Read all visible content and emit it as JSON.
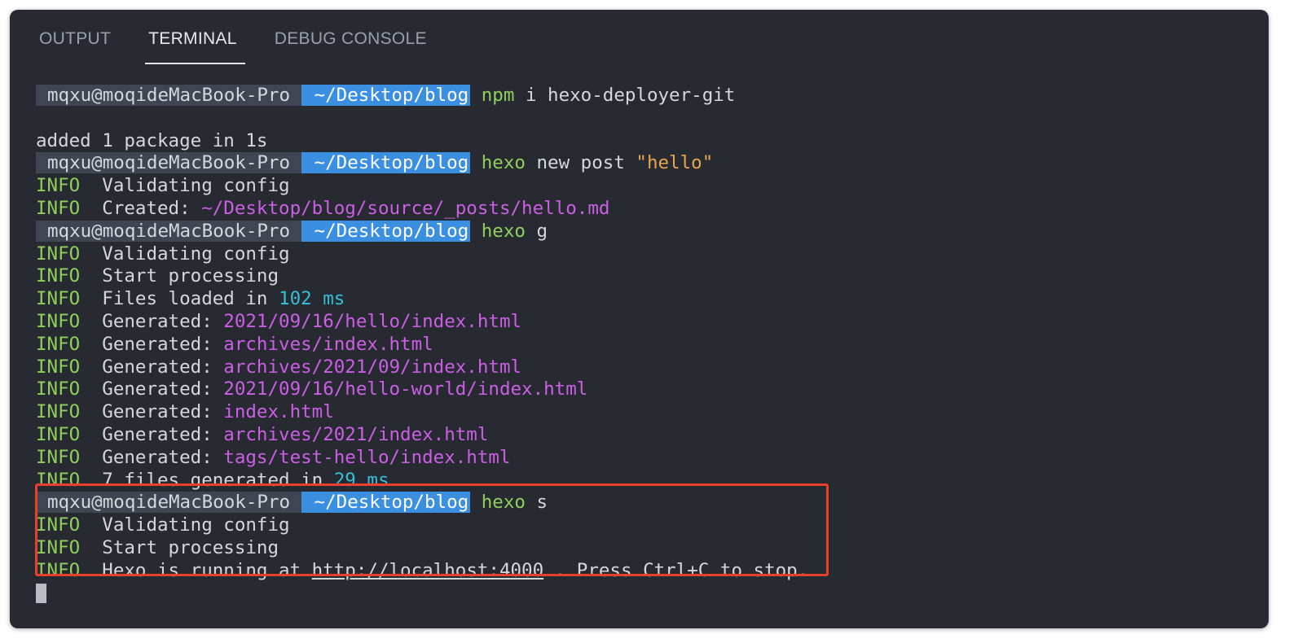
{
  "tabs": [
    {
      "label": "OUTPUT",
      "active": false
    },
    {
      "label": "TERMINAL",
      "active": true
    },
    {
      "label": "DEBUG CONSOLE",
      "active": false
    }
  ],
  "prompt": {
    "user": "mqxu@moqideMacBook-Pro",
    "path": " ~/Desktop/blog",
    "icon_left": "",
    "icon_right": ""
  },
  "lines": [
    {
      "type": "prompt",
      "cmd": "npm",
      "args": " i hexo-deployer-git"
    },
    {
      "type": "blank"
    },
    {
      "type": "plain",
      "text": "added 1 package in 1s"
    },
    {
      "type": "prompt",
      "cmd": "hexo",
      "args": " new post ",
      "string": "\"hello\""
    },
    {
      "type": "info",
      "text": "Validating config"
    },
    {
      "type": "info",
      "label": "Created: ",
      "hl": "~/Desktop/blog/source/_posts/hello.md",
      "hl_color": "magenta"
    },
    {
      "type": "prompt",
      "cmd": "hexo",
      "args": " g"
    },
    {
      "type": "info",
      "text": "Validating config"
    },
    {
      "type": "info",
      "text": "Start processing"
    },
    {
      "type": "info",
      "label": "Files loaded in ",
      "hl": "102 ms",
      "hl_color": "cyan"
    },
    {
      "type": "info",
      "label": "Generated: ",
      "hl": "2021/09/16/hello/index.html",
      "hl_color": "magenta"
    },
    {
      "type": "info",
      "label": "Generated: ",
      "hl": "archives/index.html",
      "hl_color": "magenta"
    },
    {
      "type": "info",
      "label": "Generated: ",
      "hl": "archives/2021/09/index.html",
      "hl_color": "magenta"
    },
    {
      "type": "info",
      "label": "Generated: ",
      "hl": "2021/09/16/hello-world/index.html",
      "hl_color": "magenta"
    },
    {
      "type": "info",
      "label": "Generated: ",
      "hl": "index.html",
      "hl_color": "magenta"
    },
    {
      "type": "info",
      "label": "Generated: ",
      "hl": "archives/2021/index.html",
      "hl_color": "magenta"
    },
    {
      "type": "info",
      "label": "Generated: ",
      "hl": "tags/test-hello/index.html",
      "hl_color": "magenta"
    },
    {
      "type": "info",
      "label": "7 files generated in ",
      "hl": "29 ms",
      "hl_color": "cyan"
    },
    {
      "type": "prompt",
      "cmd": "hexo",
      "args": " s"
    },
    {
      "type": "info",
      "text": "Validating config"
    },
    {
      "type": "info",
      "text": "Start processing"
    },
    {
      "type": "info",
      "label": "Hexo is running at ",
      "url": "http://localhost:4000",
      "suffix": " . Press Ctrl+C to stop."
    },
    {
      "type": "cursor"
    }
  ],
  "info_tag": "INFO",
  "colors": {
    "background": "#272a31",
    "info_green": "#8fcf5c",
    "magenta": "#cc5fe6",
    "cyan": "#34bfd6",
    "path_blue": "#3b8fe0",
    "highlight_red": "#e8402c"
  }
}
